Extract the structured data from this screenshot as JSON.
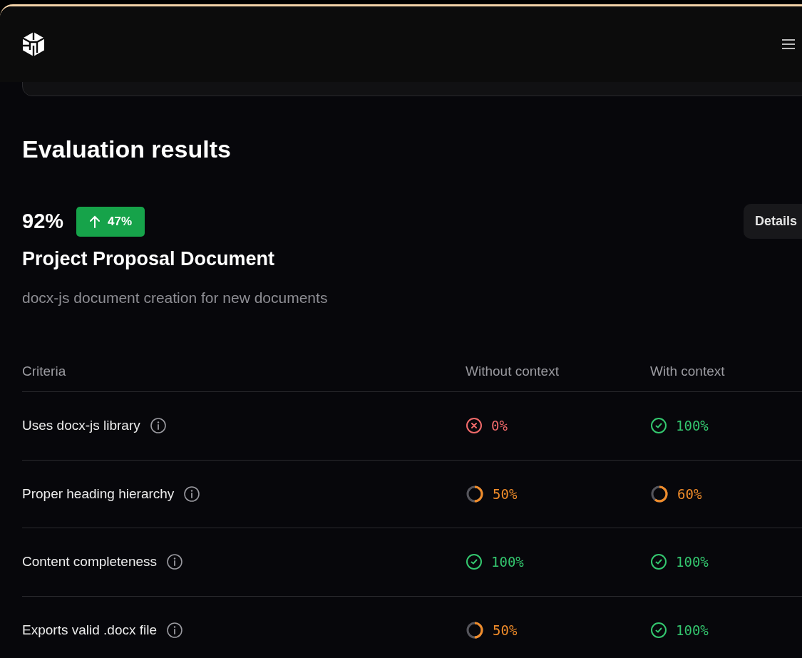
{
  "title": "Evaluation results",
  "score": {
    "value": "92%",
    "change": "47%"
  },
  "details_button": "Details",
  "eval": {
    "name": "Project Proposal Document",
    "description": "docx-js document creation for new documents"
  },
  "table": {
    "columns": [
      "Criteria",
      "Without context",
      "With context"
    ],
    "rows": [
      {
        "criterion": "Uses docx-js library",
        "without": {
          "kind": "fail",
          "text": "0%"
        },
        "with": {
          "kind": "pass",
          "text": "100%"
        }
      },
      {
        "criterion": "Proper heading hierarchy",
        "without": {
          "kind": "partial",
          "text": "50%"
        },
        "with": {
          "kind": "partial",
          "text": "60%"
        }
      },
      {
        "criterion": "Content completeness",
        "without": {
          "kind": "pass",
          "text": "100%"
        },
        "with": {
          "kind": "pass",
          "text": "100%"
        }
      },
      {
        "criterion": "Exports valid .docx file",
        "without": {
          "kind": "partial",
          "text": "50%"
        },
        "with": {
          "kind": "pass",
          "text": "100%"
        }
      }
    ]
  }
}
